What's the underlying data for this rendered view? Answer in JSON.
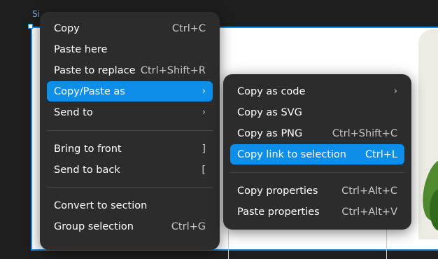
{
  "canvas": {
    "frame_label": "Si"
  },
  "main_menu": {
    "items": [
      {
        "label": "Copy",
        "shortcut": "Ctrl+C"
      },
      {
        "label": "Paste here",
        "shortcut": ""
      },
      {
        "label": "Paste to replace",
        "shortcut": "Ctrl+Shift+R"
      },
      {
        "label": "Copy/Paste as",
        "shortcut": "›",
        "active": true
      },
      {
        "label": "Send to",
        "shortcut": "›"
      },
      {
        "label": "Bring to front",
        "shortcut": "]"
      },
      {
        "label": "Send to back",
        "shortcut": "["
      },
      {
        "label": "Convert to section",
        "shortcut": ""
      },
      {
        "label": "Group selection",
        "shortcut": "Ctrl+G"
      }
    ]
  },
  "sub_menu": {
    "items": [
      {
        "label": "Copy as code",
        "shortcut": "›"
      },
      {
        "label": "Copy as SVG",
        "shortcut": ""
      },
      {
        "label": "Copy as PNG",
        "shortcut": "Ctrl+Shift+C"
      },
      {
        "label": "Copy link to selection",
        "shortcut": "Ctrl+L",
        "active": true
      },
      {
        "label": "Copy properties",
        "shortcut": "Ctrl+Alt+C"
      },
      {
        "label": "Paste properties",
        "shortcut": "Ctrl+Alt+V"
      }
    ]
  },
  "colors": {
    "menu_bg": "#2c2c2c",
    "highlight": "#0d8ee9",
    "selection_border": "#1a8fe8",
    "canvas_bg": "#1e1e1e"
  },
  "icons": {
    "submenu_arrow": "chevron-right-icon"
  }
}
